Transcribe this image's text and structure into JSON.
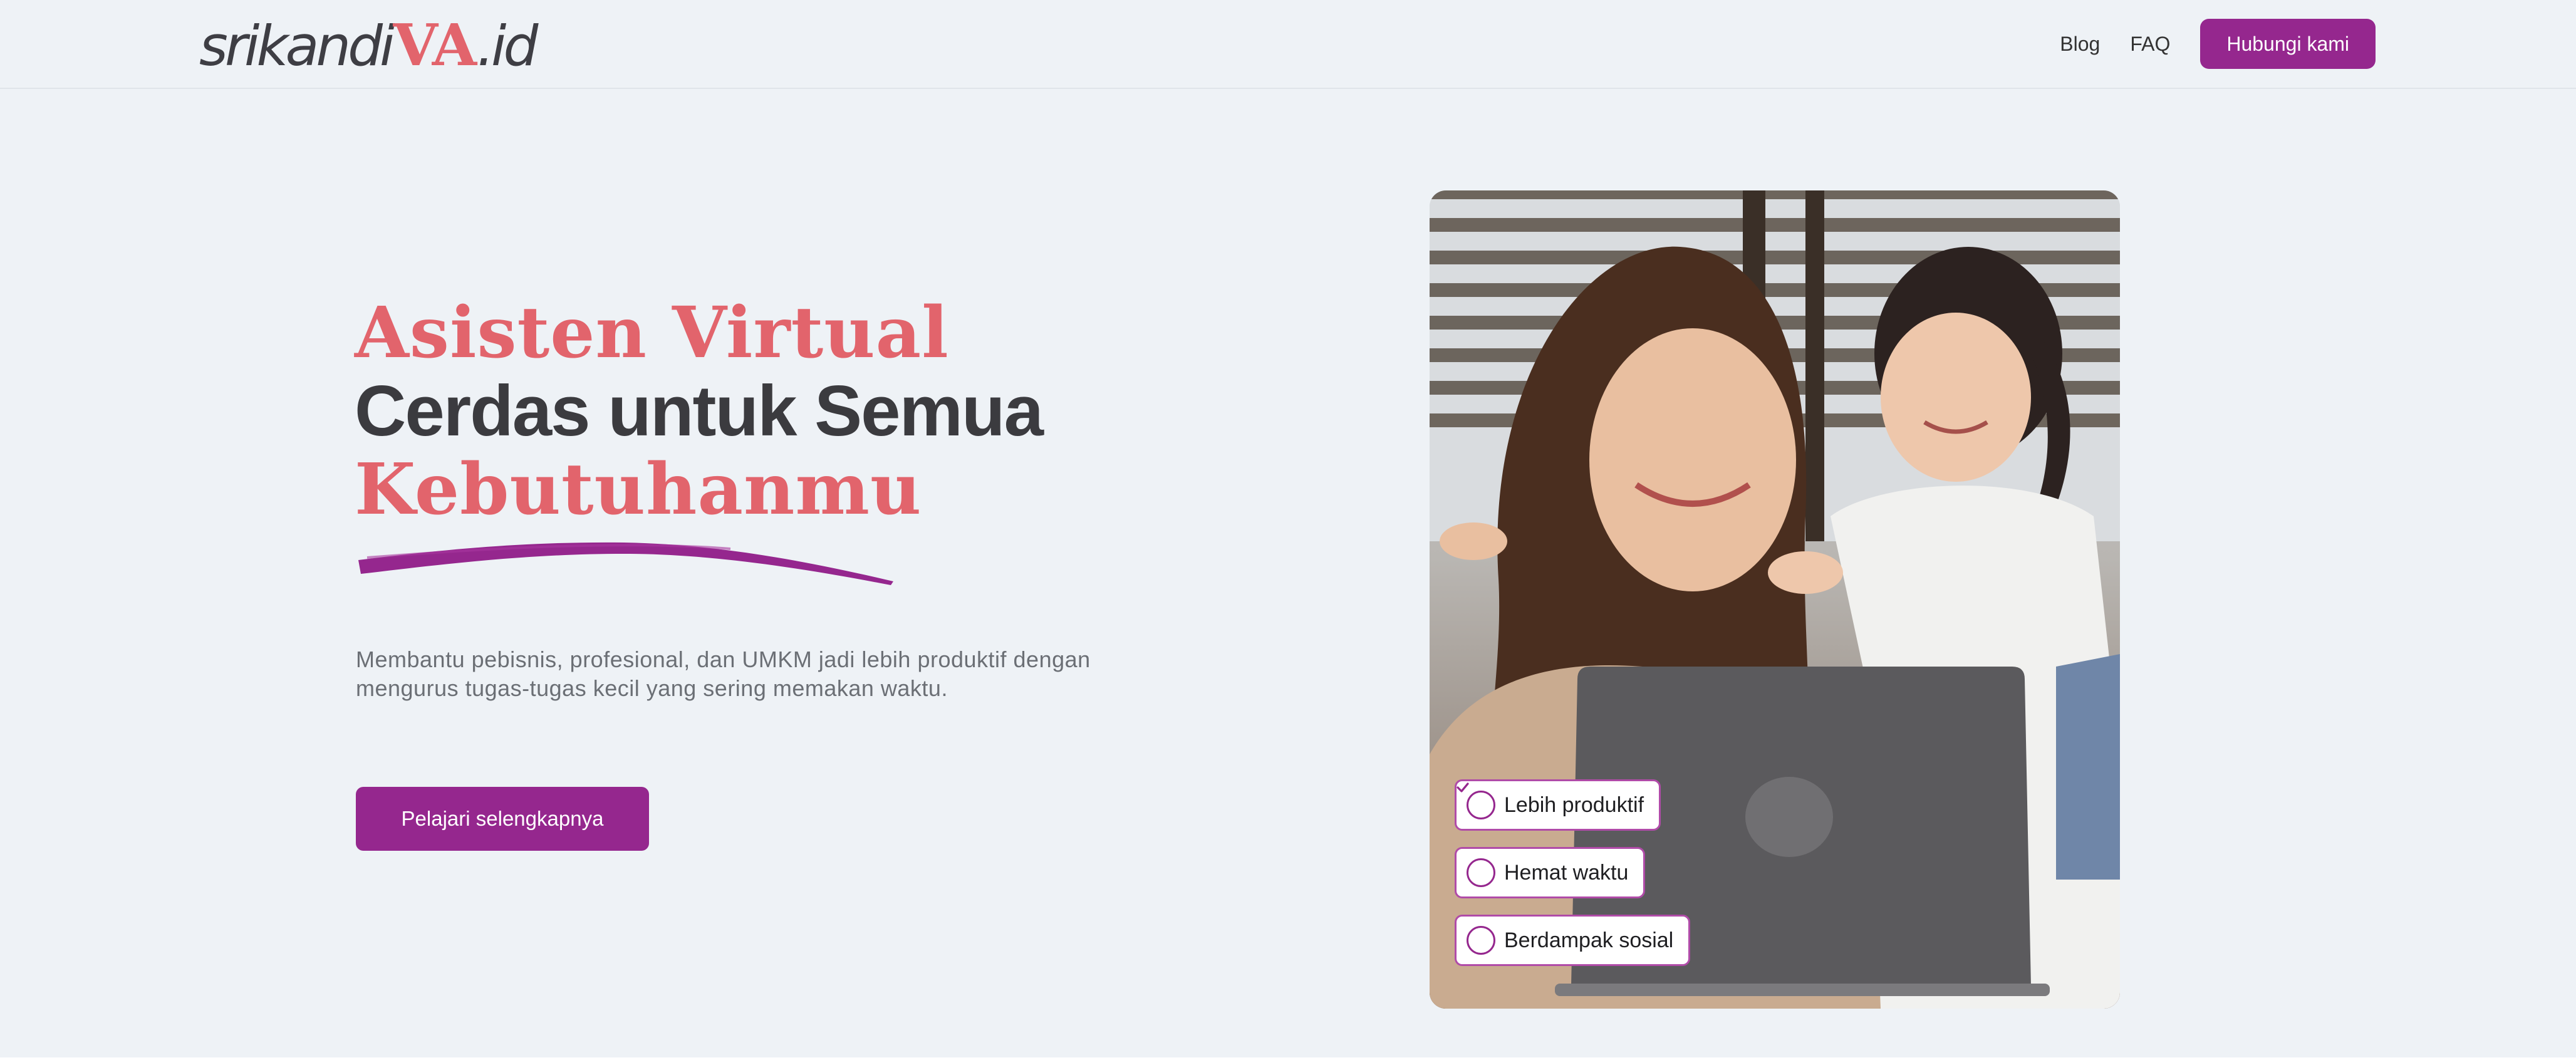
{
  "brand": {
    "logo_prefix": "srikandi",
    "logo_va": "VA",
    "logo_suffix": ".id",
    "accent_color": "#e2646c",
    "primary_color": "#95278e"
  },
  "nav": {
    "links": [
      "Blog",
      "FAQ"
    ],
    "contact_label": "Hubungi kami"
  },
  "hero": {
    "title_line1": "Asisten  Virtual",
    "title_line2": "Cerdas untuk Semua",
    "title_line3": "Kebutuhanmu",
    "description": "Membantu pebisnis, profesional, dan UMKM jadi lebih produktif dengan mengurus tugas-tugas kecil yang sering memakan waktu.",
    "cta_label": "Pelajari selengkapnya"
  },
  "benefits": [
    {
      "label": "Lebih produktif",
      "icon": "check-icon"
    },
    {
      "label": "Hemat waktu",
      "icon": "check-icon"
    },
    {
      "label": "Berdampak sosial",
      "icon": "check-icon"
    }
  ]
}
